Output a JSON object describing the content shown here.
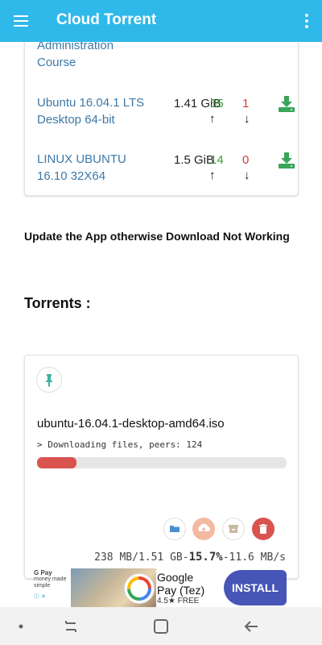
{
  "app": {
    "title": "Cloud Torrent"
  },
  "results": [
    {
      "name_lines": [
        "Administration",
        "Course"
      ]
    },
    {
      "name_lines": [
        "Ubuntu 16.04.1 LTS",
        "Desktop 64-bit"
      ],
      "size": "1.41 GiB",
      "seeders": "35",
      "leechers": "1"
    },
    {
      "name_lines": [
        "LINUX UBUNTU",
        "16.10 32X64"
      ],
      "size": "1.5 GiB",
      "seeders": "14",
      "leechers": "0"
    }
  ],
  "notice": "Update the App otherwise Download Not Working",
  "section_title": "Torrents :",
  "torrent": {
    "name": "ubuntu-16.04.1-desktop-amd64.iso",
    "status": "> Downloading files, peers: 124",
    "progress": 0.157,
    "stats_prefix": "238 MB/1.51 GB-",
    "percent": "15.7%",
    "stats_suffix": "-11.6 MB/s"
  },
  "ad": {
    "brand_line1": "G Pay",
    "brand_line2": "money made simple",
    "title_line1": "Google",
    "title_line2": "Pay (Tez)",
    "rating": "4.5★ FREE",
    "install_label": "INSTALL"
  },
  "colors": {
    "appbar": "#2fb8ea",
    "link": "#3d79a8",
    "seed": "#3a9a3a",
    "leech": "#d23a3a",
    "install": "#4655b6"
  }
}
